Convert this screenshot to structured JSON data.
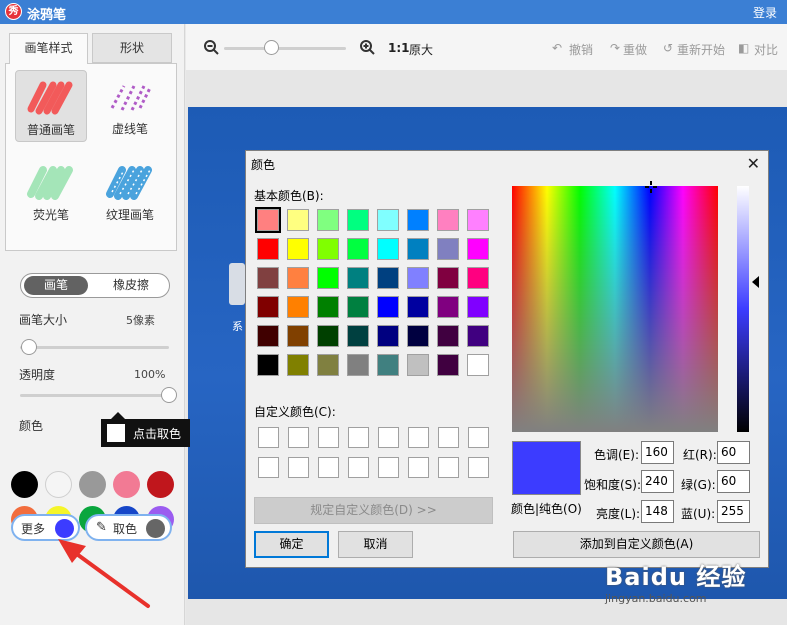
{
  "app": {
    "title": "涂鸦笔",
    "login": "登录",
    "logo_char": "秀"
  },
  "left_panel": {
    "tabs": [
      "画笔样式",
      "形状"
    ],
    "brushes": [
      "普通画笔",
      "虚线笔",
      "荧光笔",
      "纹理画笔"
    ],
    "mode_tabs": [
      "画笔",
      "橡皮擦"
    ],
    "brush_size": {
      "label": "画笔大小",
      "value": "5像素",
      "fraction": 0.05
    },
    "opacity": {
      "label": "透明度",
      "value": "100%",
      "fraction": 1.0
    },
    "color_label": "颜色",
    "tooltip": "点击取色",
    "swatches": [
      "#000000",
      "#f5f5f5",
      "#999999",
      "#f27a94",
      "#c0161c",
      "#f26d3d",
      "#f5f52a",
      "#0aa63e",
      "#1646c8",
      "#9b5cf0"
    ],
    "more_label": "更多",
    "more_color": "#3c3cff",
    "pick_label": "取色",
    "pick_color": "#666666"
  },
  "toolbar": {
    "zoom_label": "1:1",
    "original_label": "原大",
    "undo": "撤销",
    "redo": "重做",
    "restart": "重新开始",
    "compare": "对比"
  },
  "desktop": {
    "icon_label": "系"
  },
  "color_dialog": {
    "title": "颜色",
    "basic_label": "基本颜色(B):",
    "basic_colors": [
      "#ff8080",
      "#ffff80",
      "#80ff80",
      "#00ff80",
      "#80ffff",
      "#0080ff",
      "#ff80c0",
      "#ff80ff",
      "#ff0000",
      "#ffff00",
      "#80ff00",
      "#00ff40",
      "#00ffff",
      "#0080c0",
      "#8080c0",
      "#ff00ff",
      "#804040",
      "#ff8040",
      "#00ff00",
      "#008080",
      "#004080",
      "#8080ff",
      "#800040",
      "#ff0080",
      "#800000",
      "#ff8000",
      "#008000",
      "#008040",
      "#0000ff",
      "#0000a0",
      "#800080",
      "#8000ff",
      "#400000",
      "#804000",
      "#004000",
      "#004040",
      "#000080",
      "#000040",
      "#400040",
      "#400080",
      "#000000",
      "#808000",
      "#808040",
      "#808080",
      "#408080",
      "#c0c0c0",
      "#400040",
      "#ffffff"
    ],
    "custom_label": "自定义颜色(C):",
    "define_button": "规定自定义颜色(D) >>",
    "ok_button": "确定",
    "cancel_button": "取消",
    "preview_label": "颜色|纯色(O)",
    "fields": {
      "hue": {
        "label": "色调(E):",
        "value": "160"
      },
      "sat": {
        "label": "饱和度(S):",
        "value": "240"
      },
      "lum": {
        "label": "亮度(L):",
        "value": "148"
      },
      "red": {
        "label": "红(R):",
        "value": "60"
      },
      "green": {
        "label": "绿(G):",
        "value": "60"
      },
      "blue": {
        "label": "蓝(U):",
        "value": "255"
      }
    },
    "add_custom_button": "添加到自定义颜色(A)",
    "current_color": "#3c3cff"
  },
  "watermark": {
    "brand": "Baidu 经验",
    "url": "jingyan.baidu.com"
  }
}
